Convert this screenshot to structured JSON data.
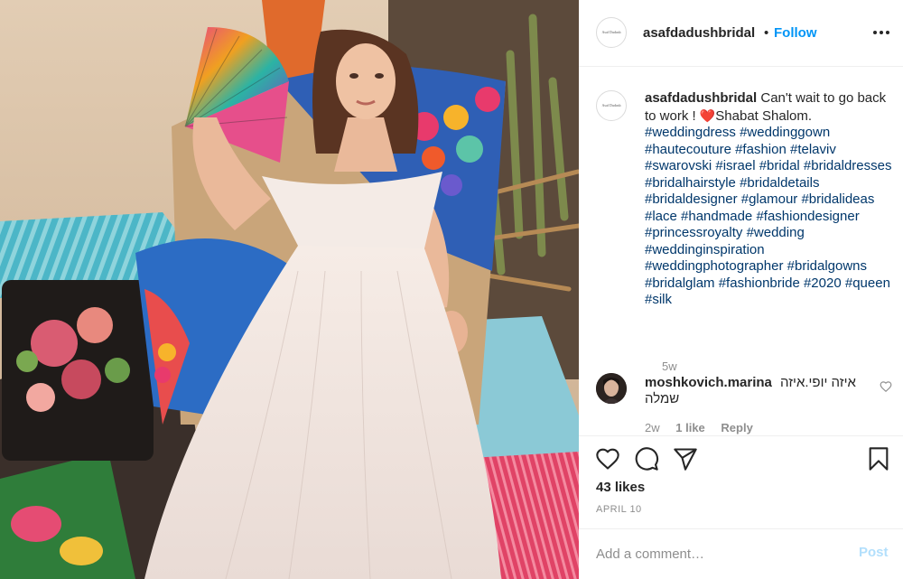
{
  "header": {
    "avatar_text": "Asaf Dudush",
    "username": "asafdadushbridal",
    "separator": "•",
    "follow_label": "Follow",
    "more_icon": "more-horizontal-icon"
  },
  "caption": {
    "username": "asafdadushbridal",
    "text_before_emoji": "Can't wait to go back to work ! ",
    "emoji": "❤️",
    "text_after_emoji": "Shabat Shalom.",
    "hashtags": [
      "#weddingdress",
      "#weddinggown",
      "#hautecouture",
      "#fashion",
      "#telaviv",
      "#swarovski",
      "#israel",
      "#bridal",
      "#bridaldresses",
      "#bridalhairstyle",
      "#bridaldetails",
      "#bridaldesigner",
      "#glamour",
      "#bridalideas",
      "#lace",
      "#handmade",
      "#fashiondesigner",
      "#princessroyalty",
      "#wedding",
      "#weddinginspiration",
      "#weddingphotographer",
      "#bridalgowns",
      "#bridalglam",
      "#fashionbride",
      "#2020",
      "#queen",
      "#silk"
    ],
    "age": "5w"
  },
  "comment": {
    "username": "moshkovich.marina",
    "text_line1": "איזה יופי.איזה",
    "text_line2": "שמלה",
    "age": "2w",
    "likes": "1 like",
    "reply_label": "Reply"
  },
  "actions": {
    "like_icon": "heart-icon",
    "comment_icon": "comment-icon",
    "share_icon": "share-icon",
    "save_icon": "bookmark-icon",
    "likes": "43 likes",
    "date": "APRIL 10"
  },
  "add_comment": {
    "placeholder": "Add a comment…",
    "post_label": "Post"
  },
  "colors": {
    "follow": "#0095f6",
    "hashtag": "#00376b",
    "muted": "#8e8e8e",
    "post_disabled": "#b2dffc"
  }
}
